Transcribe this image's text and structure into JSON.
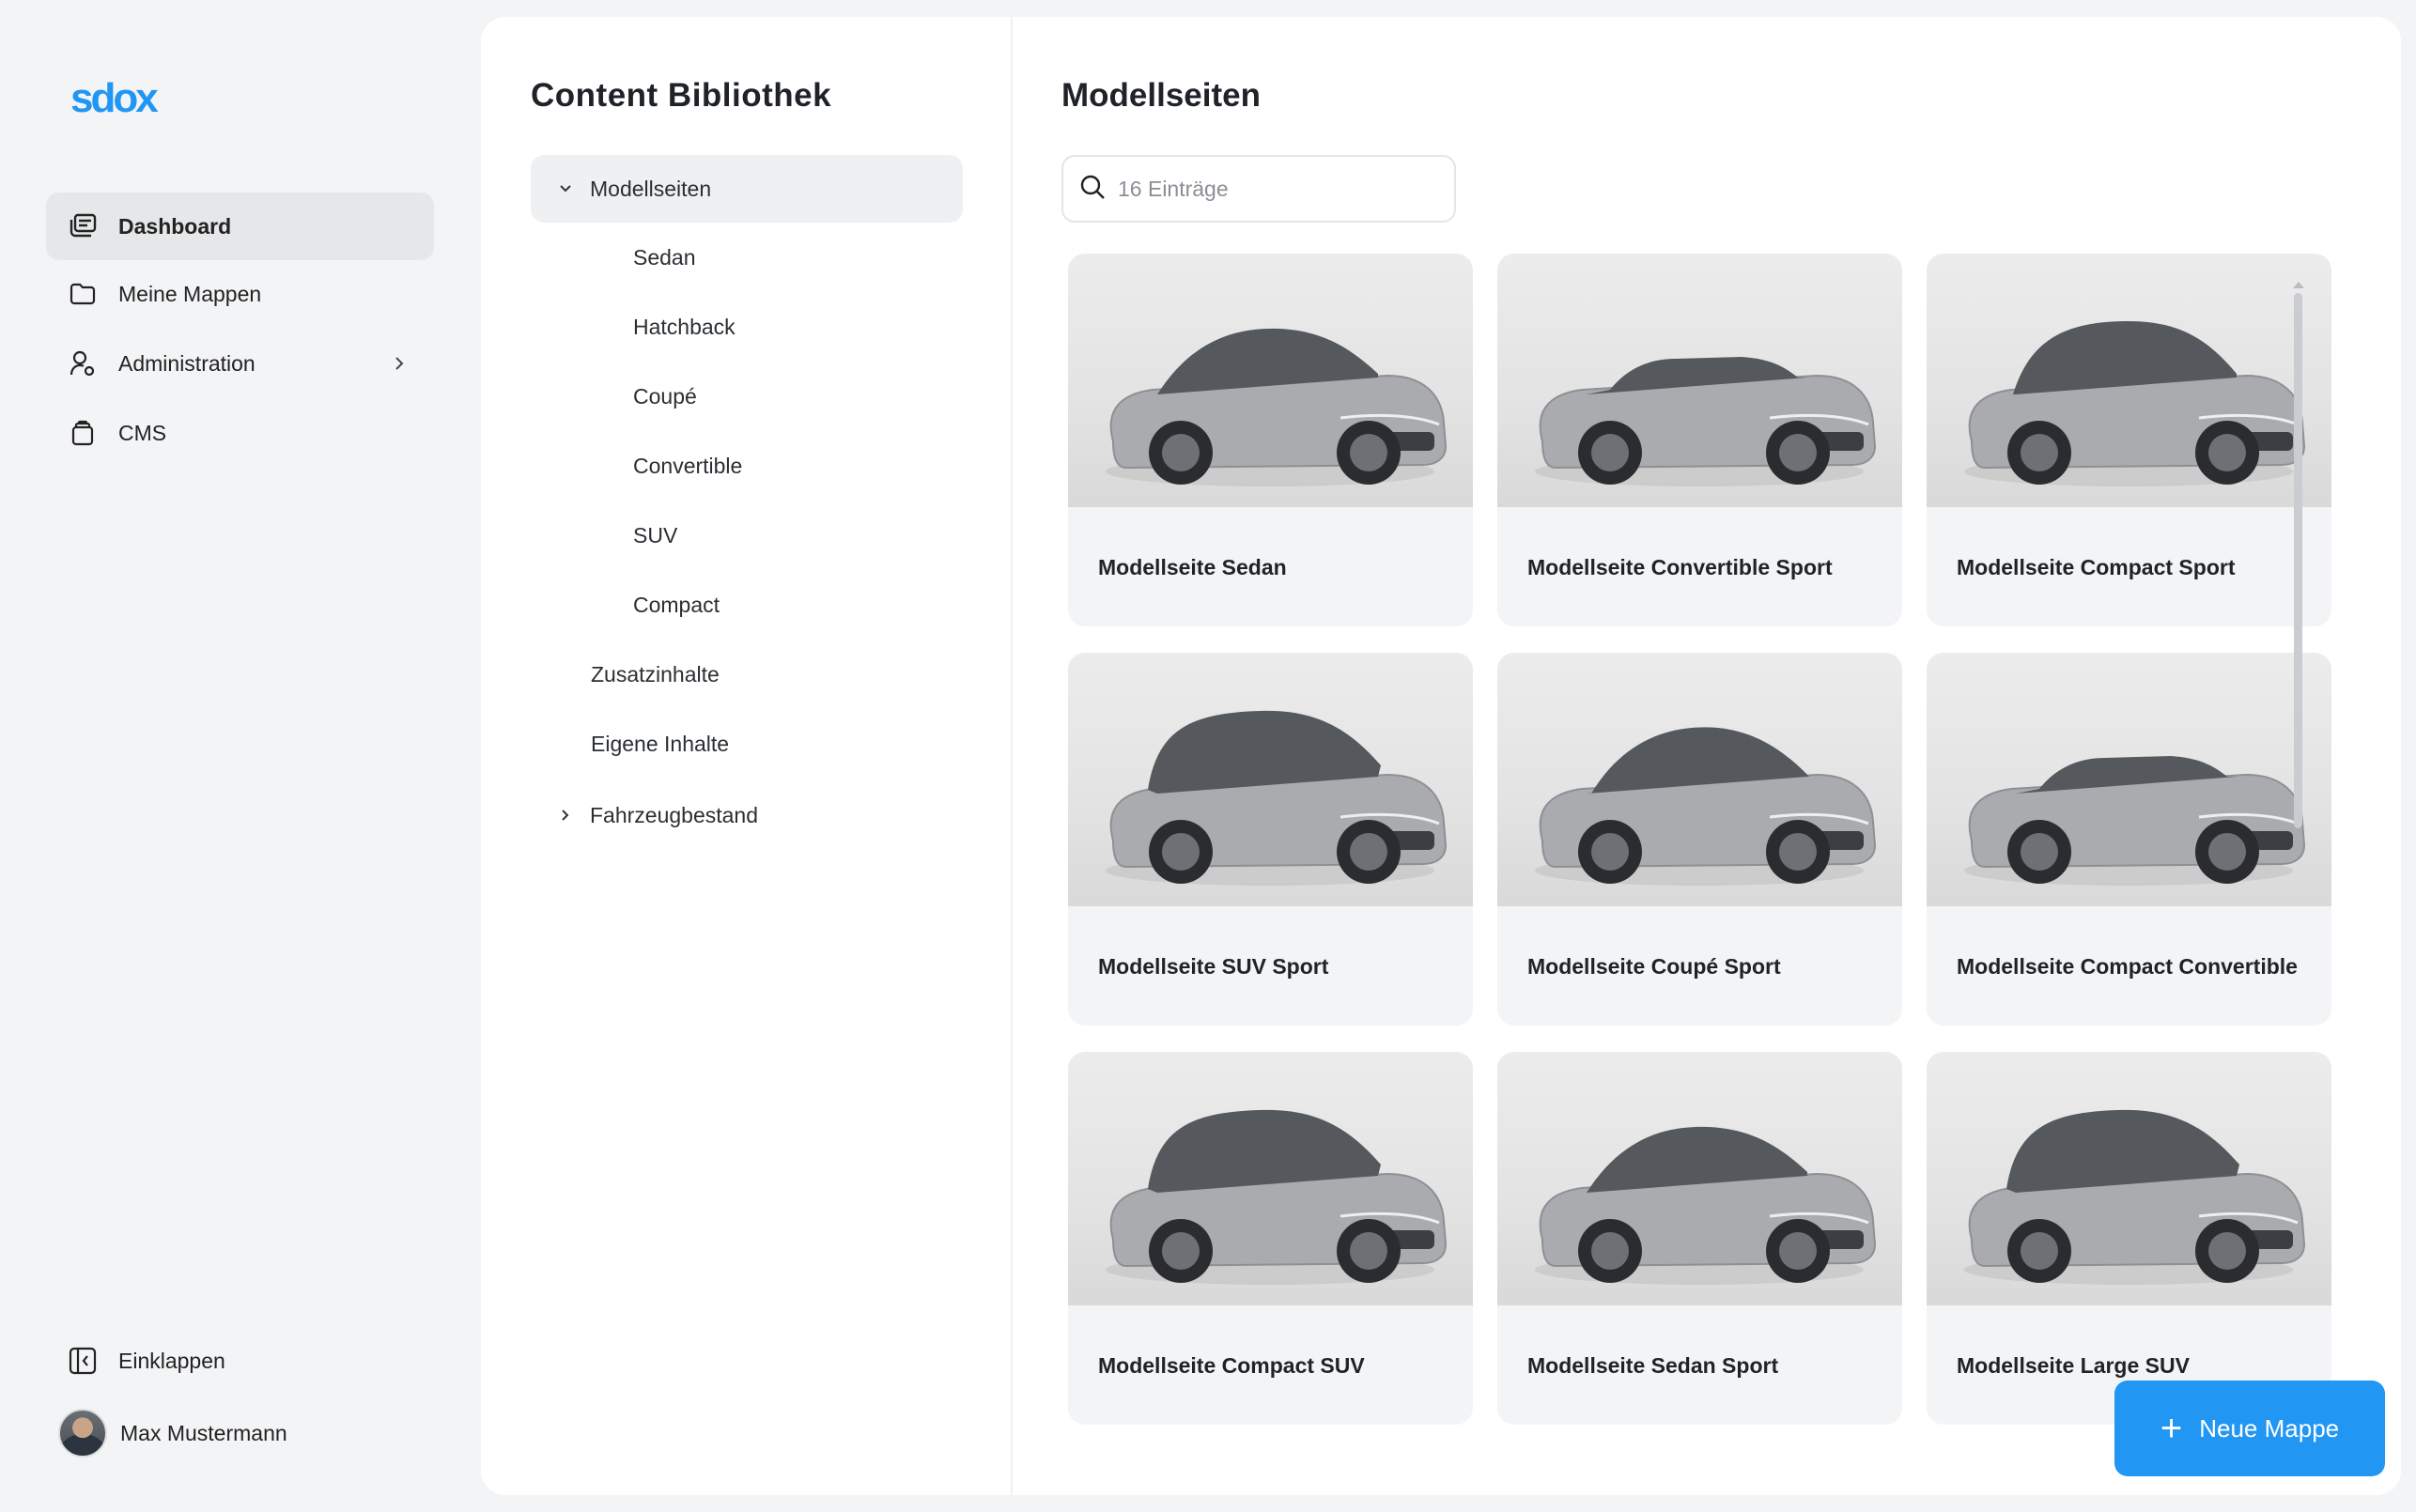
{
  "app": {
    "logo": "sdox"
  },
  "sidebar": {
    "items": [
      {
        "label": "Dashboard",
        "icon": "dashboard-icon",
        "active": true
      },
      {
        "label": "Meine Mappen",
        "icon": "folder-icon"
      },
      {
        "label": "Administration",
        "icon": "user-admin-icon",
        "has_submenu": true
      },
      {
        "label": "CMS",
        "icon": "cms-icon"
      }
    ],
    "collapse_label": "Einklappen",
    "user_name": "Max Mustermann"
  },
  "library": {
    "title": "Content Bibliothek",
    "tree": {
      "root": "Modellseiten",
      "children": [
        "Sedan",
        "Hatchback",
        "Coupé",
        "Convertible",
        "SUV",
        "Compact"
      ],
      "other": [
        "Zusatzinhalte",
        "Eigene Inhalte"
      ],
      "collapsed": "Fahrzeugbestand"
    }
  },
  "content": {
    "title": "Modellseiten",
    "search_placeholder": "16 Einträge",
    "cards": [
      {
        "label": "Modellseite Sedan",
        "body": "sedan"
      },
      {
        "label": "Modellseite Convertible Sport",
        "body": "convertible"
      },
      {
        "label": "Modellseite Compact Sport",
        "body": "hatch"
      },
      {
        "label": "Modellseite SUV Sport",
        "body": "suv"
      },
      {
        "label": "Modellseite Coupé Sport",
        "body": "coupe"
      },
      {
        "label": "Modellseite Compact Convertible",
        "body": "convertible"
      },
      {
        "label": "Modellseite Compact SUV",
        "body": "suv"
      },
      {
        "label": "Modellseite Sedan Sport",
        "body": "sedan"
      },
      {
        "label": "Modellseite Large SUV",
        "body": "suv"
      }
    ]
  },
  "fab": {
    "label": "Neue Mappe"
  },
  "colors": {
    "accent": "#2196f3",
    "background": "#f3f4f6",
    "card": "#f3f4f6"
  }
}
